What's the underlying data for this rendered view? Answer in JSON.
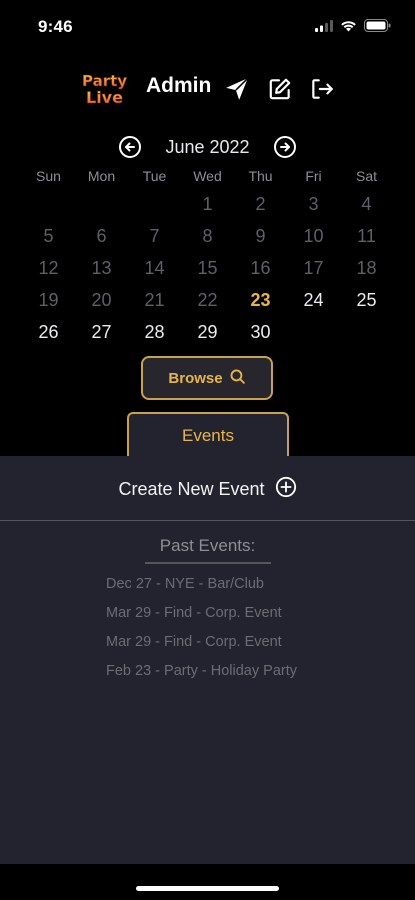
{
  "status": {
    "time": "9:46"
  },
  "header": {
    "logo_text": "Party Live",
    "title": "Admin"
  },
  "icons": {
    "send": "paper-plane-icon",
    "edit": "edit-square-icon",
    "logout": "logout-icon",
    "prev": "chevron-left-circle-icon",
    "next": "chevron-right-circle-icon",
    "search": "search-icon",
    "add": "plus-circle-icon"
  },
  "calendar": {
    "month_label": "June 2022",
    "weekdays": [
      "Sun",
      "Mon",
      "Tue",
      "Wed",
      "Thu",
      "Fri",
      "Sat"
    ],
    "weeks": [
      [
        "",
        "",
        "",
        "1",
        "2",
        "3",
        "4"
      ],
      [
        "5",
        "6",
        "7",
        "8",
        "9",
        "10",
        "11"
      ],
      [
        "12",
        "13",
        "14",
        "15",
        "16",
        "17",
        "18"
      ],
      [
        "19",
        "20",
        "21",
        "22",
        "23",
        "24",
        "25"
      ],
      [
        "26",
        "27",
        "28",
        "29",
        "30",
        "",
        ""
      ]
    ],
    "today": "23"
  },
  "browse": {
    "label": "Browse"
  },
  "tabs": {
    "events_label": "Events"
  },
  "events": {
    "create_label": "Create New Event",
    "past_title": "Past Events:",
    "past_items": [
      "Dec 27 - NYE -  Bar/Club",
      "Mar 29 - Find -  Corp. Event",
      "Mar 29 - Find -  Corp. Event",
      "Feb 23 - Party -  Holiday Party"
    ]
  },
  "colors": {
    "accent": "#e8b54c",
    "panel": "#23232f",
    "background": "#000000"
  }
}
